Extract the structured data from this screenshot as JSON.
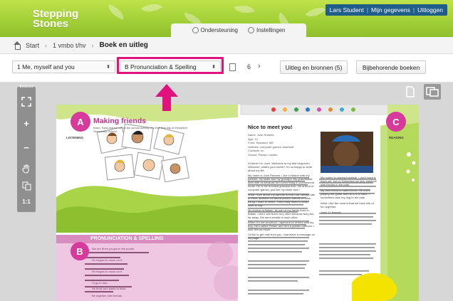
{
  "header": {
    "logo_line1": "Stepping",
    "logo_line2": "Stones",
    "user_links": [
      "Lars Student",
      "Mijn gegevens",
      "Uitloggen"
    ],
    "utility_tabs": [
      "Ondersteuning",
      "Instellingen"
    ]
  },
  "breadcrumb": {
    "items": [
      "Start",
      "1 vmbo t/hv",
      "Boek en uitleg"
    ]
  },
  "toolbar": {
    "chapter_select": "1 Me, myself and you",
    "section_select": "B Pronunciation & Spelling",
    "page_number": "6",
    "sources_button": "Uitleg en bronnen (5)",
    "books_button": "Bijbehorende boeken"
  },
  "side_tools": [
    "expand",
    "zoom-in",
    "zoom-out",
    "pan",
    "select",
    "1:1"
  ],
  "side_tools_labels": {
    "actual_size": "1:1"
  },
  "book": {
    "left": {
      "section_a_letter": "A",
      "section_a_title": "Making friends",
      "section_a_intro": "Bram, Sara and Ali met at the school activity. It's their first day at Hempster Secondary School.",
      "section_a_tag": "LISTENING",
      "section_b_letter": "B",
      "section_b_title": "PRONUNCIATION & SPELLING",
      "section_b_line1": "We are three people in the poster.",
      "section_b_line2": "He begins to move on it.",
      "section_b_line3": "He begins to move on it.",
      "section_b_line4": "I'll go to fast.",
      "section_b_line5": "He finds and starts to think.",
      "section_b_line6": "Be together with friends."
    },
    "right": {
      "section_c_letter": "C",
      "section_c_tag": "READING",
      "article_title": "Nice to meet you!",
      "profile": [
        "Name: Josh Roberts",
        "Age: 13",
        "From: Stamford, ME",
        "Hobbies: computer games, baseball",
        "Contacts: no",
        "School: Please I visited"
      ],
      "body": [
        "Hi there! I'm Josh. Welcome to my first blog ever! Welcome, what's your name? I'm so happy to write about my life.",
        "My name is Josh Roberts. I live in Maine with my parents, my sister and my grandpa. My grandfather lives with us because he's been living in a retirement home. He is the funniest grandpa ever. He is fond of computer games, just like my sister and I.",
        "What I love about my parents is that I can always talk to them, whether it's about school, friends or other things I want to share. They really listen to what I have to say.",
        "My brother is British, as part of my family lives in Britain. I don't see them very often because they live far away. We send emails to each other.",
        "When I'm not at school, I spend a lot of time with my dog. He's called Timber and he's a golden retriever. I love him so much.",
        "I'd like to get mail from you. Just leave a message on my page."
      ],
      "side_column": [
        "My hobby is playing baseball. I don't have a team yet, but on Saturdays we play baseball with friends in the park.",
        "My best friend is called Kevin. He loves playing the guitar and he is in a band. I sometimes take my dog to the park.",
        "What I like the most is that we have lots of fun together.",
        "Josh: O. Barnes"
      ]
    }
  },
  "colors": {
    "header_green": "#a3d038",
    "highlight_pink": "#e0137e",
    "user_bar_blue": "#1f5d8a",
    "section_purple": "#d63a9a",
    "viewer_gray": "#d7d7d7"
  }
}
